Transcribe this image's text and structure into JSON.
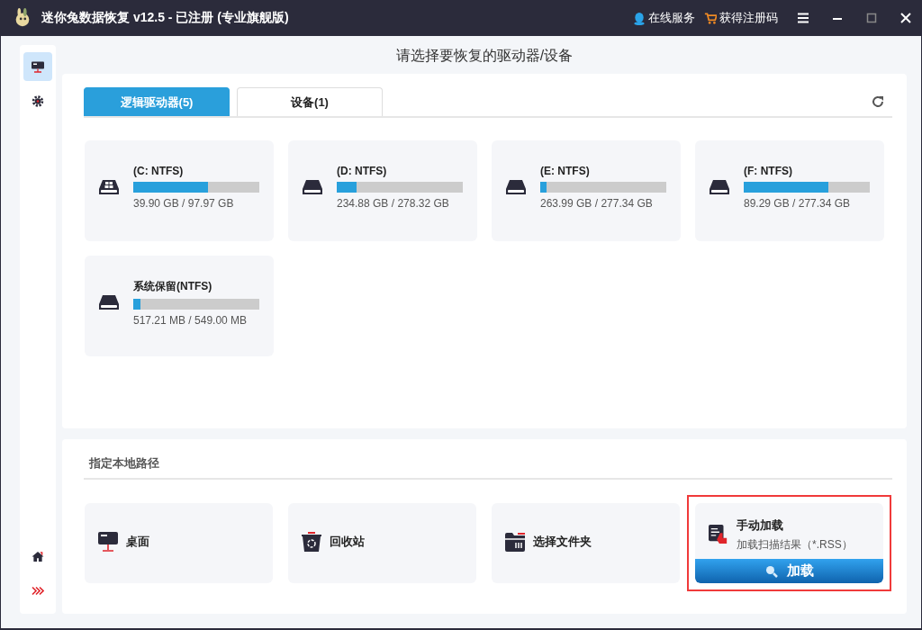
{
  "window": {
    "title": "迷你兔数据恢复 v12.5 - 已注册 (专业旗舰版)",
    "links": [
      {
        "kind": "service",
        "label": "在线服务"
      },
      {
        "kind": "register",
        "label": "获得注册码"
      }
    ]
  },
  "sidebar": {
    "items": [
      {
        "kind": "drives",
        "selected": true
      },
      {
        "kind": "settings",
        "selected": false
      }
    ],
    "bottom": [
      {
        "kind": "home"
      },
      {
        "kind": "expand"
      }
    ]
  },
  "heading": "请选择要恢复的驱动器/设备",
  "tabs": [
    {
      "label": "逻辑驱动器(5)",
      "selected": true
    },
    {
      "label": "设备(1)",
      "selected": false
    }
  ],
  "drives": [
    {
      "kind": "system",
      "name": "(C: NTFS)",
      "level": 0.59,
      "size": "39.90 GB / 97.97 GB"
    },
    {
      "kind": "disk",
      "name": "(D: NTFS)",
      "level": 0.156,
      "size": "234.88 GB / 278.32 GB"
    },
    {
      "kind": "disk",
      "name": "(E: NTFS)",
      "level": 0.048,
      "size": "263.99 GB / 277.34 GB"
    },
    {
      "kind": "disk",
      "name": "(F: NTFS)",
      "level": 0.67,
      "size": "89.29 GB / 277.34 GB"
    },
    {
      "kind": "disk",
      "name": "系统保留(NTFS)",
      "level": 0.058,
      "size": "517.21 MB / 549.00 MB"
    }
  ],
  "local_path": {
    "title": "指定本地路径",
    "items": [
      {
        "kind": "desktop",
        "label": "桌面",
        "highlighted": false
      },
      {
        "kind": "recycle",
        "label": "回收站",
        "highlighted": false
      },
      {
        "kind": "folder",
        "label": "选择文件夹",
        "highlighted": false
      },
      {
        "kind": "load",
        "label": "手动加载",
        "subtitle": "加载扫描结果（*.RSS）",
        "button": "加载",
        "highlighted": true
      }
    ]
  }
}
